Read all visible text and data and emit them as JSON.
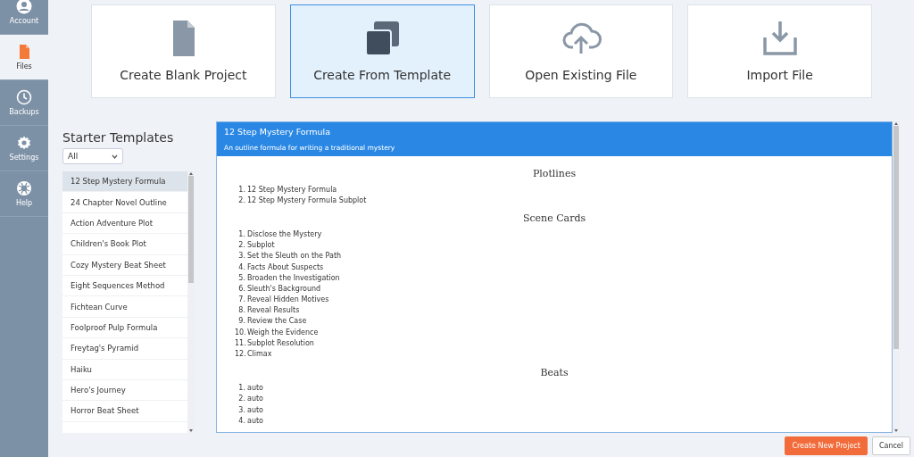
{
  "sidebar": {
    "items": [
      {
        "label": "Account",
        "selected": false
      },
      {
        "label": "Files",
        "selected": true
      },
      {
        "label": "Backups",
        "selected": false
      },
      {
        "label": "Settings",
        "selected": false
      },
      {
        "label": "Help",
        "selected": false
      }
    ]
  },
  "actions": [
    {
      "label": "Create Blank Project",
      "selected": false
    },
    {
      "label": "Create From Template",
      "selected": true
    },
    {
      "label": "Open Existing File",
      "selected": false
    },
    {
      "label": "Import File",
      "selected": false
    }
  ],
  "templates": {
    "title": "Starter Templates",
    "filter": "All",
    "items": [
      {
        "label": "12 Step Mystery Formula",
        "selected": true
      },
      {
        "label": "24 Chapter Novel Outline",
        "selected": false
      },
      {
        "label": "Action Adventure Plot",
        "selected": false
      },
      {
        "label": "Children's Book Plot",
        "selected": false
      },
      {
        "label": "Cozy Mystery Beat Sheet",
        "selected": false
      },
      {
        "label": "Eight Sequences Method",
        "selected": false
      },
      {
        "label": "Fichtean Curve",
        "selected": false
      },
      {
        "label": "Foolproof Pulp Formula",
        "selected": false
      },
      {
        "label": "Freytag's Pyramid",
        "selected": false
      },
      {
        "label": "Haiku",
        "selected": false
      },
      {
        "label": "Hero's Journey",
        "selected": false
      },
      {
        "label": "Horror Beat Sheet",
        "selected": false
      }
    ]
  },
  "detail": {
    "title": "12 Step Mystery Formula",
    "description": "An outline formula for writing a traditional mystery",
    "sections": [
      {
        "heading": "Plotlines",
        "items": [
          {
            "number": "1.",
            "text": "12 Step Mystery Formula"
          },
          {
            "number": "2.",
            "text": "12 Step Mystery Formula Subplot"
          }
        ]
      },
      {
        "heading": "Scene Cards",
        "items": [
          {
            "number": "1.",
            "text": "Disclose the Mystery"
          },
          {
            "number": "2.",
            "text": "Subplot"
          },
          {
            "number": "3.",
            "text": "Set the Sleuth on the Path"
          },
          {
            "number": "4.",
            "text": "Facts About Suspects"
          },
          {
            "number": "5.",
            "text": "Broaden the Investigation"
          },
          {
            "number": "6.",
            "text": "Sleuth's Background"
          },
          {
            "number": "7.",
            "text": "Reveal Hidden Motives"
          },
          {
            "number": "8.",
            "text": "Reveal Results"
          },
          {
            "number": "9.",
            "text": "Review the Case"
          },
          {
            "number": "10.",
            "text": "Weigh the Evidence"
          },
          {
            "number": "11.",
            "text": "Subplot Resolution"
          },
          {
            "number": "12.",
            "text": "Climax"
          }
        ]
      },
      {
        "heading": "Beats",
        "items": [
          {
            "number": "1.",
            "text": "auto"
          },
          {
            "number": "2.",
            "text": "auto"
          },
          {
            "number": "3.",
            "text": "auto"
          },
          {
            "number": "4.",
            "text": "auto"
          }
        ]
      }
    ]
  },
  "buttons": [
    {
      "label": "Create New Project",
      "kind": "primary"
    },
    {
      "label": "Cancel",
      "kind": "secondary"
    }
  ]
}
